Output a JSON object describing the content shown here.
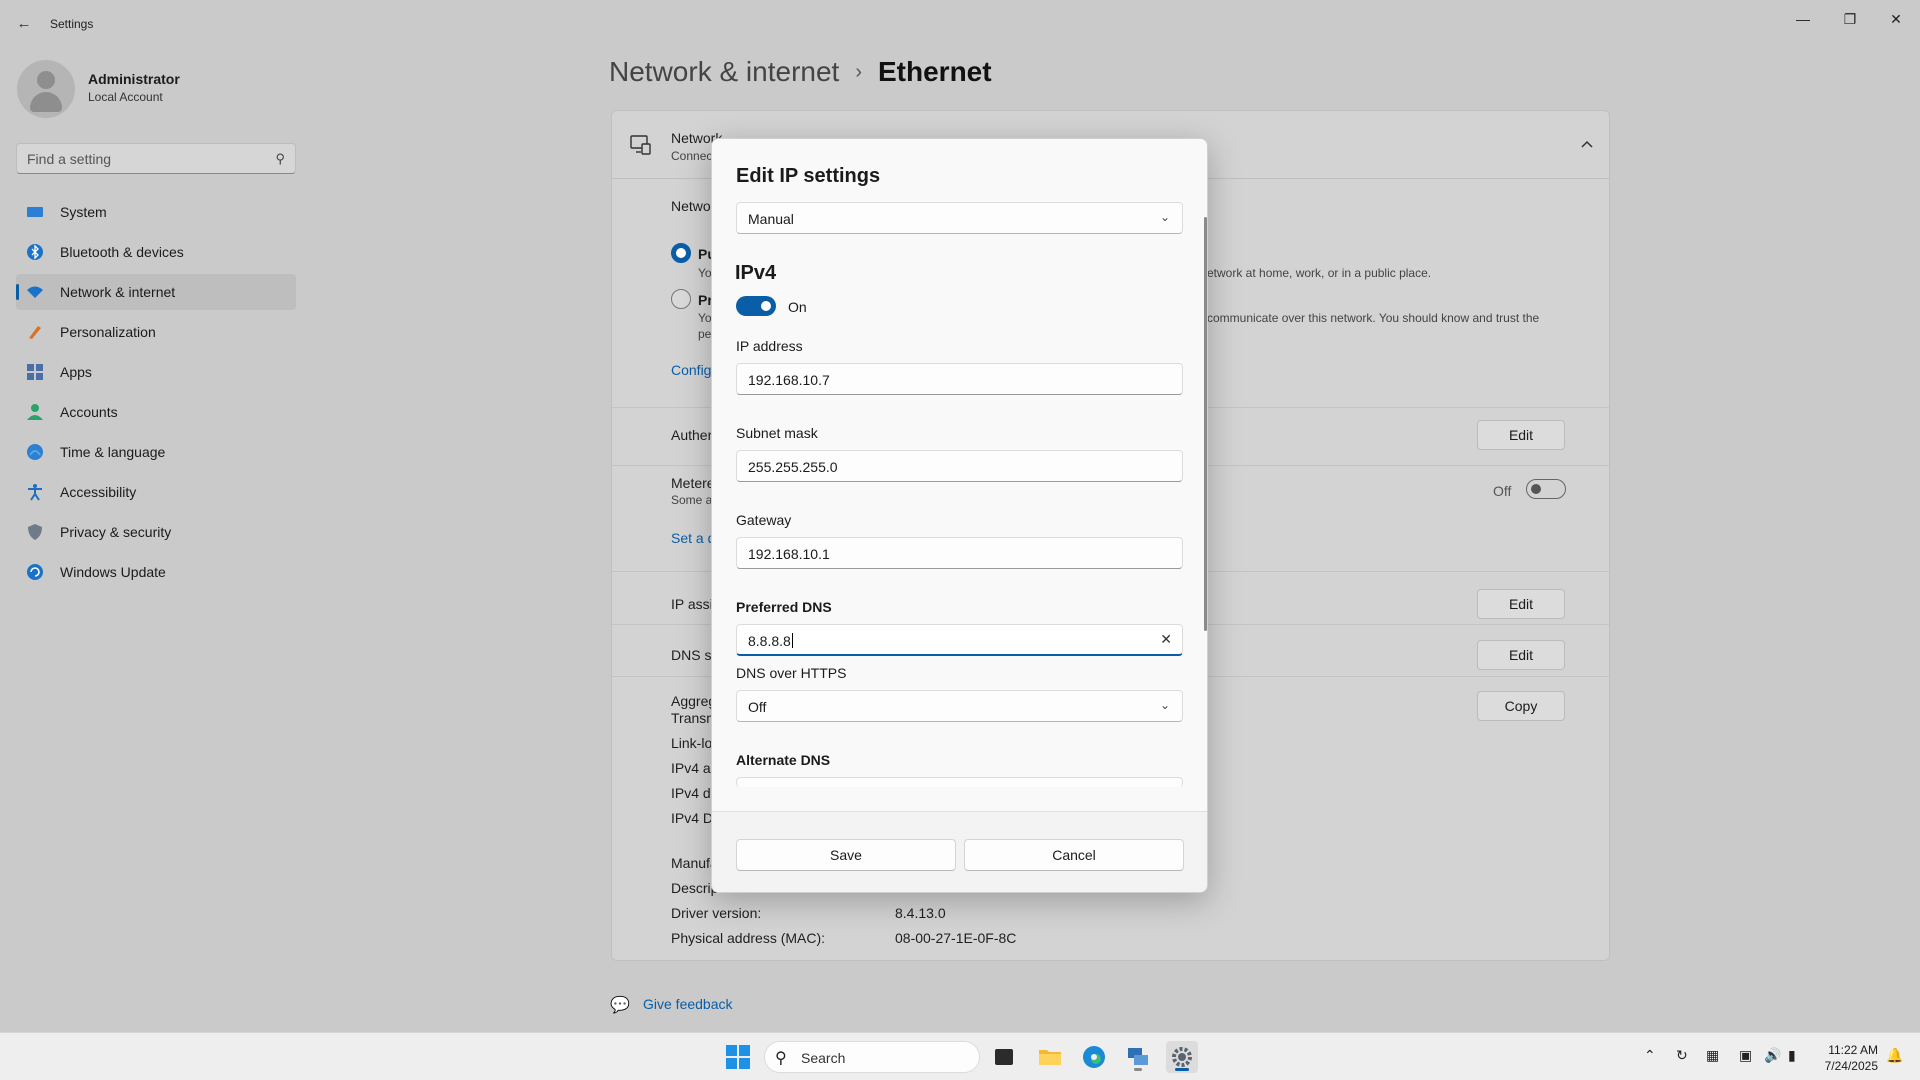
{
  "window": {
    "title": "Settings",
    "back_glyph": "←",
    "minimize_glyph": "—",
    "restore_glyph": "❐",
    "close_glyph": "✕"
  },
  "profile": {
    "name": "Administrator",
    "account_type": "Local Account"
  },
  "search": {
    "placeholder": "Find a setting"
  },
  "nav": {
    "items": [
      {
        "label": "System",
        "icon": "system-icon",
        "color": "#2b7fd4"
      },
      {
        "label": "Bluetooth & devices",
        "icon": "bluetooth-icon",
        "color": "#1a73c9"
      },
      {
        "label": "Network & internet",
        "icon": "wifi-icon",
        "color": "#1a73c9"
      },
      {
        "label": "Personalization",
        "icon": "brush-icon",
        "color": "#d7722b"
      },
      {
        "label": "Apps",
        "icon": "apps-icon",
        "color": "#4a6ea8"
      },
      {
        "label": "Accounts",
        "icon": "accounts-icon",
        "color": "#2aa36a"
      },
      {
        "label": "Time & language",
        "icon": "globe-clock-icon",
        "color": "#2b7fd4"
      },
      {
        "label": "Accessibility",
        "icon": "accessibility-icon",
        "color": "#1a6fc4"
      },
      {
        "label": "Privacy & security",
        "icon": "shield-icon",
        "color": "#6f7b88"
      },
      {
        "label": "Windows Update",
        "icon": "update-icon",
        "color": "#1a73c9"
      }
    ],
    "active_index": 2
  },
  "breadcrumb": {
    "parent": "Network & internet",
    "separator": "›",
    "current": "Ethernet"
  },
  "panel": {
    "header_title": "Network",
    "header_sub": "Connec",
    "profile_label": "Netwo",
    "public_label": "Pu",
    "public_desc_a": "Yo",
    "public_desc_b": "etwork at home, work, or in a public place.",
    "private_label": "Pr",
    "private_desc_a": "Yo",
    "private_desc_b": "communicate over this network. You should know and trust the",
    "private_desc_c": "pe",
    "configure_link": "Config",
    "auth_label": "Auther",
    "metered_label": "Metere",
    "metered_sub": "Some a",
    "metered_state": "Off",
    "data_limit_link": "Set a d",
    "ip_assign_label": "IP assig",
    "dns_label": "DNS se",
    "aggregate_label": "Aggreg",
    "transmit_label": "Transm",
    "link_local_label": "Link-lo",
    "ipv4_addr_label": "IPv4 ac",
    "ipv4_gateway_label": "IPv4 de",
    "ipv4_dns_label": "IPv4 Dl",
    "manufacturer_label": "Manufa",
    "description_label": "Descrip",
    "driver_label": "Driver version:",
    "driver_value": "8.4.13.0",
    "mac_label": "Physical address (MAC):",
    "mac_value": "08-00-27-1E-0F-8C",
    "edit_label": "Edit",
    "copy_label": "Copy"
  },
  "feedback": {
    "label": "Give feedback"
  },
  "dialog": {
    "title": "Edit IP settings",
    "mode": "Manual",
    "section": "IPv4",
    "ipv4_toggle": "On",
    "ip_address_label": "IP address",
    "ip_address": "192.168.10.7",
    "subnet_label": "Subnet mask",
    "subnet": "255.255.255.0",
    "gateway_label": "Gateway",
    "gateway": "192.168.10.1",
    "preferred_dns_label": "Preferred DNS",
    "preferred_dns": "8.8.8.8",
    "doh_label": "DNS over HTTPS",
    "doh_value": "Off",
    "alternate_dns_label": "Alternate DNS",
    "save_label": "Save",
    "cancel_label": "Cancel"
  },
  "taskbar": {
    "search_placeholder": "Search",
    "time": "11:22 AM",
    "date": "7/24/2025",
    "accent": "#0a5ea8"
  }
}
